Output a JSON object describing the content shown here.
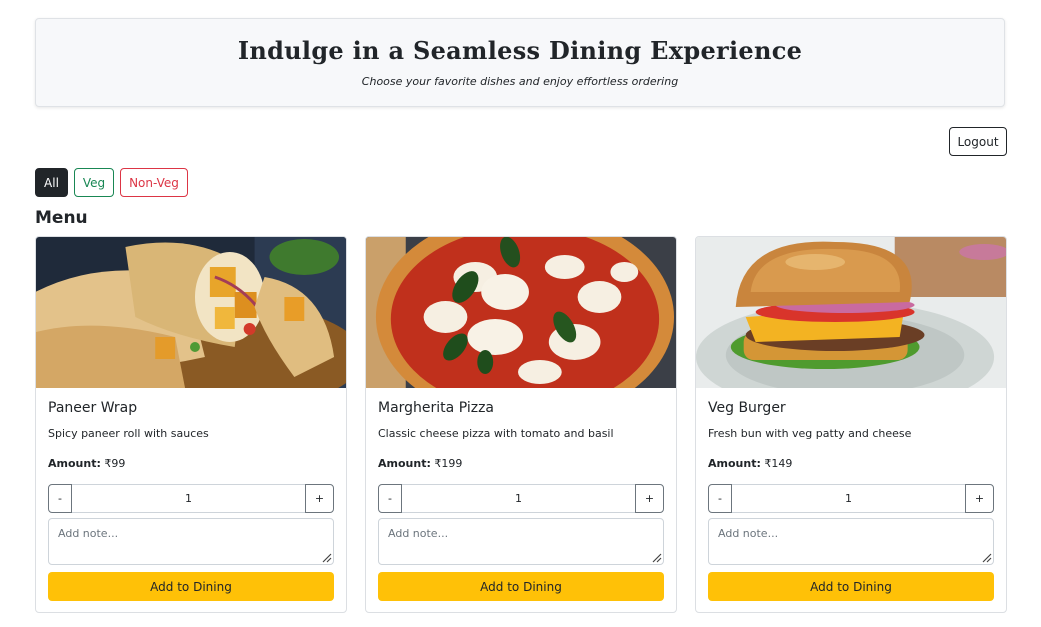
{
  "header": {
    "title": "Indulge in a Seamless Dining Experience",
    "subtitle": "Choose your favorite dishes and enjoy effortless ordering"
  },
  "logout_label": "Logout",
  "filters": {
    "all": "All",
    "veg": "Veg",
    "nonveg": "Non-Veg",
    "active": "All"
  },
  "menu_title": "Menu",
  "colors": {
    "veg": "#198754",
    "nonveg": "#dc3545",
    "add_button": "#ffc107",
    "dark": "#212529"
  },
  "items": [
    {
      "name": "Paneer Wrap",
      "description": "Spicy paneer roll with sauces",
      "amount_label": "Amount:",
      "price": "₹99",
      "qty_minus": "-",
      "quantity": "1",
      "qty_plus": "+",
      "note_placeholder": "Add note...",
      "add_label": "Add to Dining"
    },
    {
      "name": "Margherita Pizza",
      "description": "Classic cheese pizza with tomato and basil",
      "amount_label": "Amount:",
      "price": "₹199",
      "qty_minus": "-",
      "quantity": "1",
      "qty_plus": "+",
      "note_placeholder": "Add note...",
      "add_label": "Add to Dining"
    },
    {
      "name": "Veg Burger",
      "description": "Fresh bun with veg patty and cheese",
      "amount_label": "Amount:",
      "price": "₹149",
      "qty_minus": "-",
      "quantity": "1",
      "qty_plus": "+",
      "note_placeholder": "Add note...",
      "add_label": "Add to Dining"
    }
  ]
}
